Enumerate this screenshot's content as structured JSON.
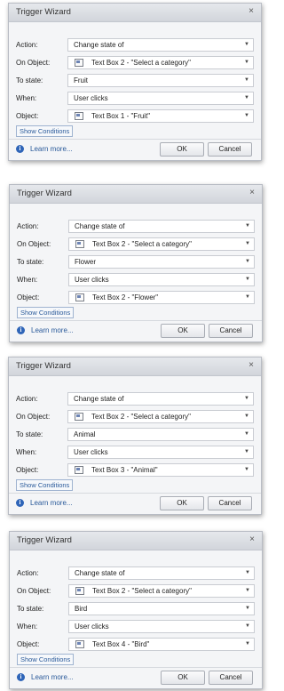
{
  "common": {
    "title": "Trigger Wizard",
    "close_glyph": "×",
    "labels": {
      "action": "Action:",
      "on_object": "On Object:",
      "to_state": "To state:",
      "when": "When:",
      "object": "Object:"
    },
    "show_conditions": "Show Conditions",
    "learn_more": "Learn more...",
    "ok": "OK",
    "cancel": "Cancel",
    "dropdown_glyph": "▼",
    "info_glyph": "i"
  },
  "dialogs": [
    {
      "action": "Change state of",
      "on_object": "Text Box 2 - \"Select a category\"",
      "to_state": "Fruit",
      "when": "User clicks",
      "object": "Text Box 1 - \"Fruit\""
    },
    {
      "action": "Change state of",
      "on_object": "Text Box 2 - \"Select a category\"",
      "to_state": "Flower",
      "when": "User clicks",
      "object": "Text Box 2 - \"Flower\""
    },
    {
      "action": "Change state of",
      "on_object": "Text Box 2 - \"Select a category\"",
      "to_state": "Animal",
      "when": "User clicks",
      "object": "Text Box 3 - \"Animal\""
    },
    {
      "action": "Change state of",
      "on_object": "Text Box 2 - \"Select a category\"",
      "to_state": "Bird",
      "when": "User clicks",
      "object": "Text Box 4 - \"Bird\""
    }
  ]
}
